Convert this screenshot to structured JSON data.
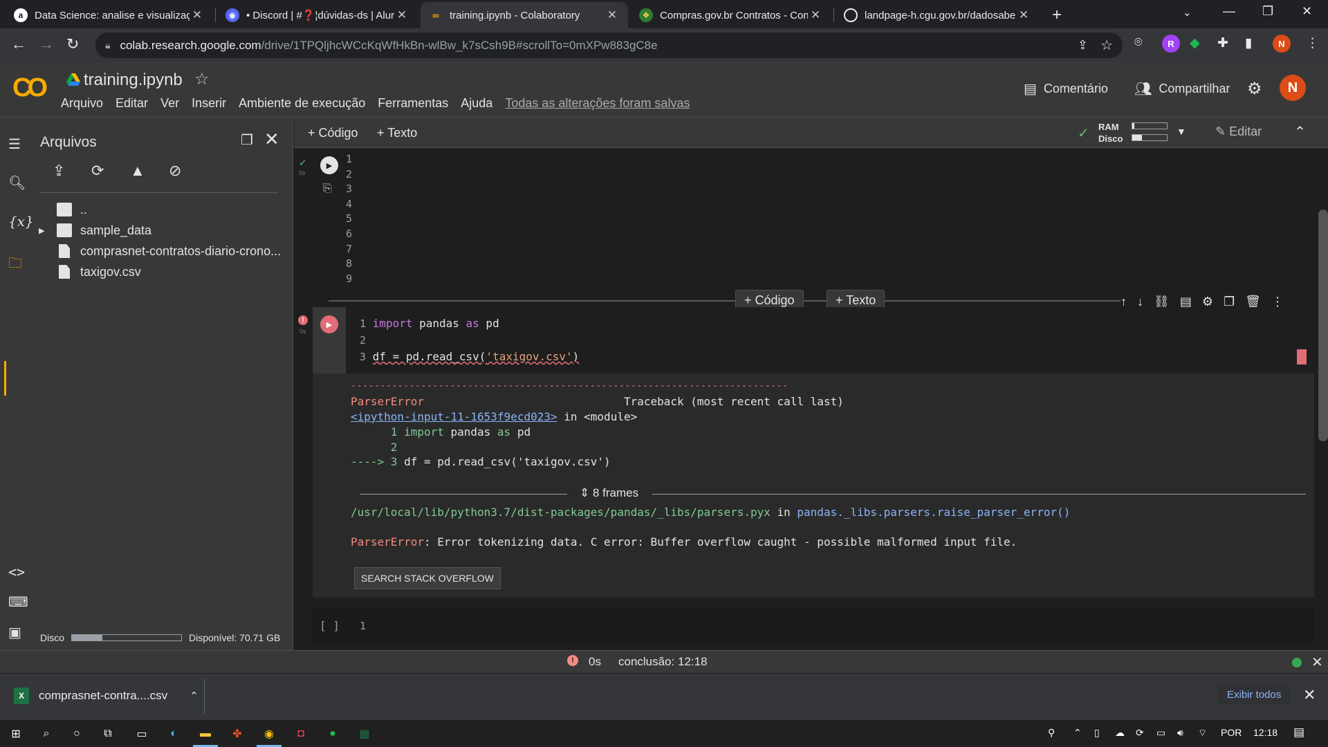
{
  "browser": {
    "tabs": [
      {
        "title": "Data Science: analise e visualizaç",
        "favicon": "a"
      },
      {
        "title": "• Discord | #❓¦dúvidas-ds | Alur",
        "favicon": "discord"
      },
      {
        "title": "training.ipynb - Colaboratory",
        "favicon": "colab"
      },
      {
        "title": "Compras.gov.br Contratos - Conj",
        "favicon": "gov"
      },
      {
        "title": "landpage-h.cgu.gov.br/dadosabe",
        "favicon": "globe"
      }
    ],
    "url_host": "colab.research.google.com",
    "url_path": "/drive/1TPQljhcWCcKqWfHkBn-wlBw_k7sCsh9B#scrollTo=0mXPw883gC8e",
    "profile_initial": "N"
  },
  "colab": {
    "logo": "CO",
    "notebook_title": "training.ipynb",
    "menu": [
      "Arquivo",
      "Editar",
      "Ver",
      "Inserir",
      "Ambiente de execução",
      "Ferramentas",
      "Ajuda"
    ],
    "saved_status": "Todas as alterações foram salvas",
    "comment_label": "Comentário",
    "share_label": "Compartilhar",
    "avatar_initial": "N"
  },
  "file_panel": {
    "title": "Arquivos",
    "rows": [
      {
        "name": "..",
        "type": "parent"
      },
      {
        "name": "sample_data",
        "type": "folder"
      },
      {
        "name": "comprasnet-contratos-diario-crono...",
        "type": "file"
      },
      {
        "name": "taxigov.csv",
        "type": "file"
      }
    ],
    "disk_label": "Disco",
    "disk_available": "Disponível: 70.71 GB",
    "disk_used_fraction": 0.28
  },
  "notebook_toolbar": {
    "add_code": "+ Código",
    "add_text": "+ Texto",
    "ram_label": "RAM",
    "disk_label": "Disco",
    "ram_fraction": 0.05,
    "disk_fraction": 0.28,
    "edit_label": "Editar"
  },
  "cell1": {
    "line_numbers": [
      "1",
      "2",
      "3",
      "4",
      "5",
      "6",
      "7",
      "8",
      "9"
    ],
    "time": "0s"
  },
  "between_cells": {
    "add_code": "+ Código",
    "add_text": "+ Texto"
  },
  "cell2": {
    "time": "0s",
    "line_numbers": [
      "1",
      "2",
      "3"
    ],
    "line1_kw1": "import",
    "line1_mod": " pandas ",
    "line1_kw2": "as",
    "line1_alias": " pd",
    "line3_code": "df = pd.read_csv(",
    "line3_str": "'taxigov.csv'",
    "line3_end": ")"
  },
  "output": {
    "dashes": "---------------------------------------------------------------------------",
    "error_name": "ParserError",
    "traceback_header": "                              Traceback (most recent call last)",
    "input_link": "<ipython-input-11-1653f9ecd023>",
    "in_module": " in <module>",
    "tb_line1_num": "      1 ",
    "tb_line1_kw1": "import",
    "tb_line1_mid": " pandas ",
    "tb_line1_kw2": "as",
    "tb_line1_end": " pd",
    "tb_line2": "      2",
    "tb_arrow": "----> 3 ",
    "tb_line3": "df = pd.read_csv('taxigov.csv')",
    "frames_label": "8 frames",
    "frame_path": "/usr/local/lib/python3.7/dist-packages/pandas/_libs/parsers.pyx",
    "frame_in": " in ",
    "frame_func": "pandas._libs.parsers.raise_parser_error()",
    "final_error_name": "ParserError",
    "final_error_msg": ": Error tokenizing data. C error: Buffer overflow caught - possible malformed input file.",
    "so_button": "SEARCH STACK OVERFLOW"
  },
  "cell3": {
    "bracket": "[ ]",
    "line_number": "1"
  },
  "status_bar": {
    "time": "0s",
    "done": "conclusão: 12:18"
  },
  "downloads": {
    "file_name": "comprasnet-contra....csv",
    "show_all": "Exibir todos"
  },
  "taskbar": {
    "language": "POR",
    "clock": "12:18"
  },
  "colors": {
    "colab_orange": "#f9ab00",
    "error_red": "#f28b82",
    "success_green": "#5bb974",
    "link_blue": "#8ab4f8"
  }
}
